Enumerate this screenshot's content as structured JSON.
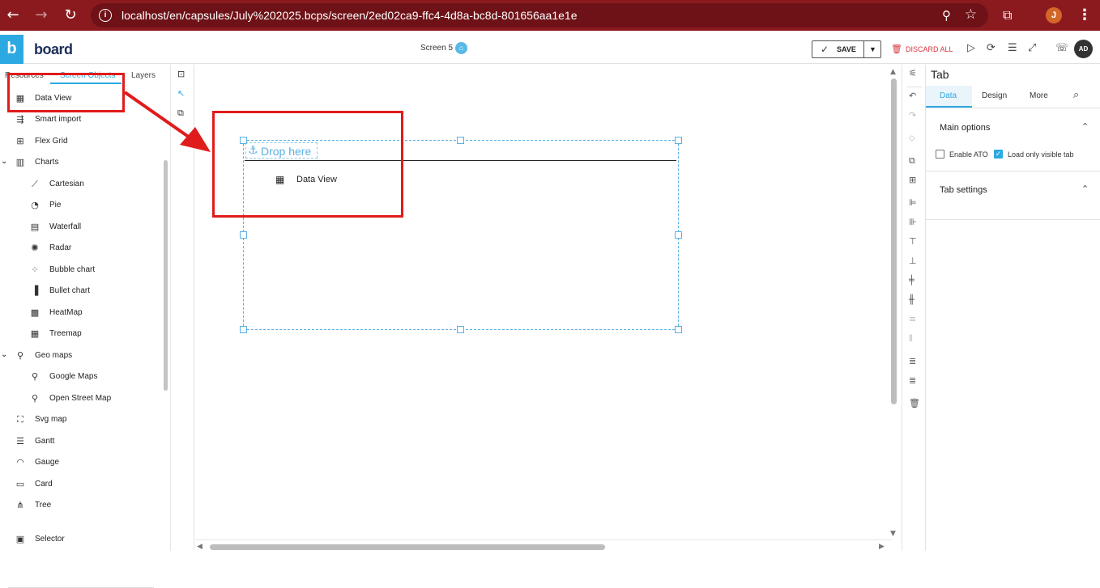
{
  "browser": {
    "url": "localhost/en/capsules/July%202025.bcps/screen/2ed02ca9-ffc4-4d8a-bc8d-801656aa1e1e",
    "profile_initial": "J"
  },
  "header": {
    "logo_letter": "b",
    "brand": "board",
    "screen_name": "Screen 5",
    "save_label": "SAVE",
    "discard_label": "DISCARD ALL",
    "user_initials": "AD"
  },
  "left_panel": {
    "tabs": [
      "Resources",
      "Screen Objects",
      "Layers"
    ],
    "active_tab": "Screen Objects",
    "items": [
      {
        "label": "Data View",
        "icon": "table-icon"
      },
      {
        "label": "Smart import",
        "icon": "smart-import-icon"
      },
      {
        "label": "Flex Grid",
        "icon": "grid-icon"
      },
      {
        "label": "Charts",
        "icon": "bar-chart-icon"
      },
      {
        "label": "Cartesian",
        "icon": "line-chart-icon"
      },
      {
        "label": "Pie",
        "icon": "pie-chart-icon"
      },
      {
        "label": "Waterfall",
        "icon": "waterfall-icon"
      },
      {
        "label": "Radar",
        "icon": "radar-icon"
      },
      {
        "label": "Bubble chart",
        "icon": "bubble-chart-icon"
      },
      {
        "label": "Bullet chart",
        "icon": "bullet-chart-icon"
      },
      {
        "label": "HeatMap",
        "icon": "heatmap-icon"
      },
      {
        "label": "Treemap",
        "icon": "treemap-icon"
      },
      {
        "label": "Geo maps",
        "icon": "geo-map-icon"
      },
      {
        "label": "Google Maps",
        "icon": "map-pin-icon"
      },
      {
        "label": "Open Street Map",
        "icon": "street-map-icon"
      },
      {
        "label": "Svg map",
        "icon": "svg-map-icon"
      },
      {
        "label": "Gantt",
        "icon": "gantt-icon"
      },
      {
        "label": "Gauge",
        "icon": "gauge-icon"
      },
      {
        "label": "Card",
        "icon": "card-icon"
      },
      {
        "label": "Tree",
        "icon": "tree-icon"
      },
      {
        "label": "Selector",
        "icon": "selector-icon"
      }
    ]
  },
  "canvas": {
    "drop_label": "Drop here",
    "dragged_item_label": "Data View"
  },
  "properties": {
    "title": "Tab",
    "tabs": [
      "Data",
      "Design",
      "More"
    ],
    "active_tab": "Data",
    "main_options_title": "Main options",
    "enable_ato_label": "Enable ATO",
    "enable_ato_checked": false,
    "load_visible_label": "Load only visible tab",
    "load_visible_checked": true,
    "tab_settings_title": "Tab settings"
  },
  "colors": {
    "accent": "#2ca9e1",
    "chrome": "#8b1a1f",
    "annotation": "#e01b1b",
    "discard": "#d9363e"
  }
}
